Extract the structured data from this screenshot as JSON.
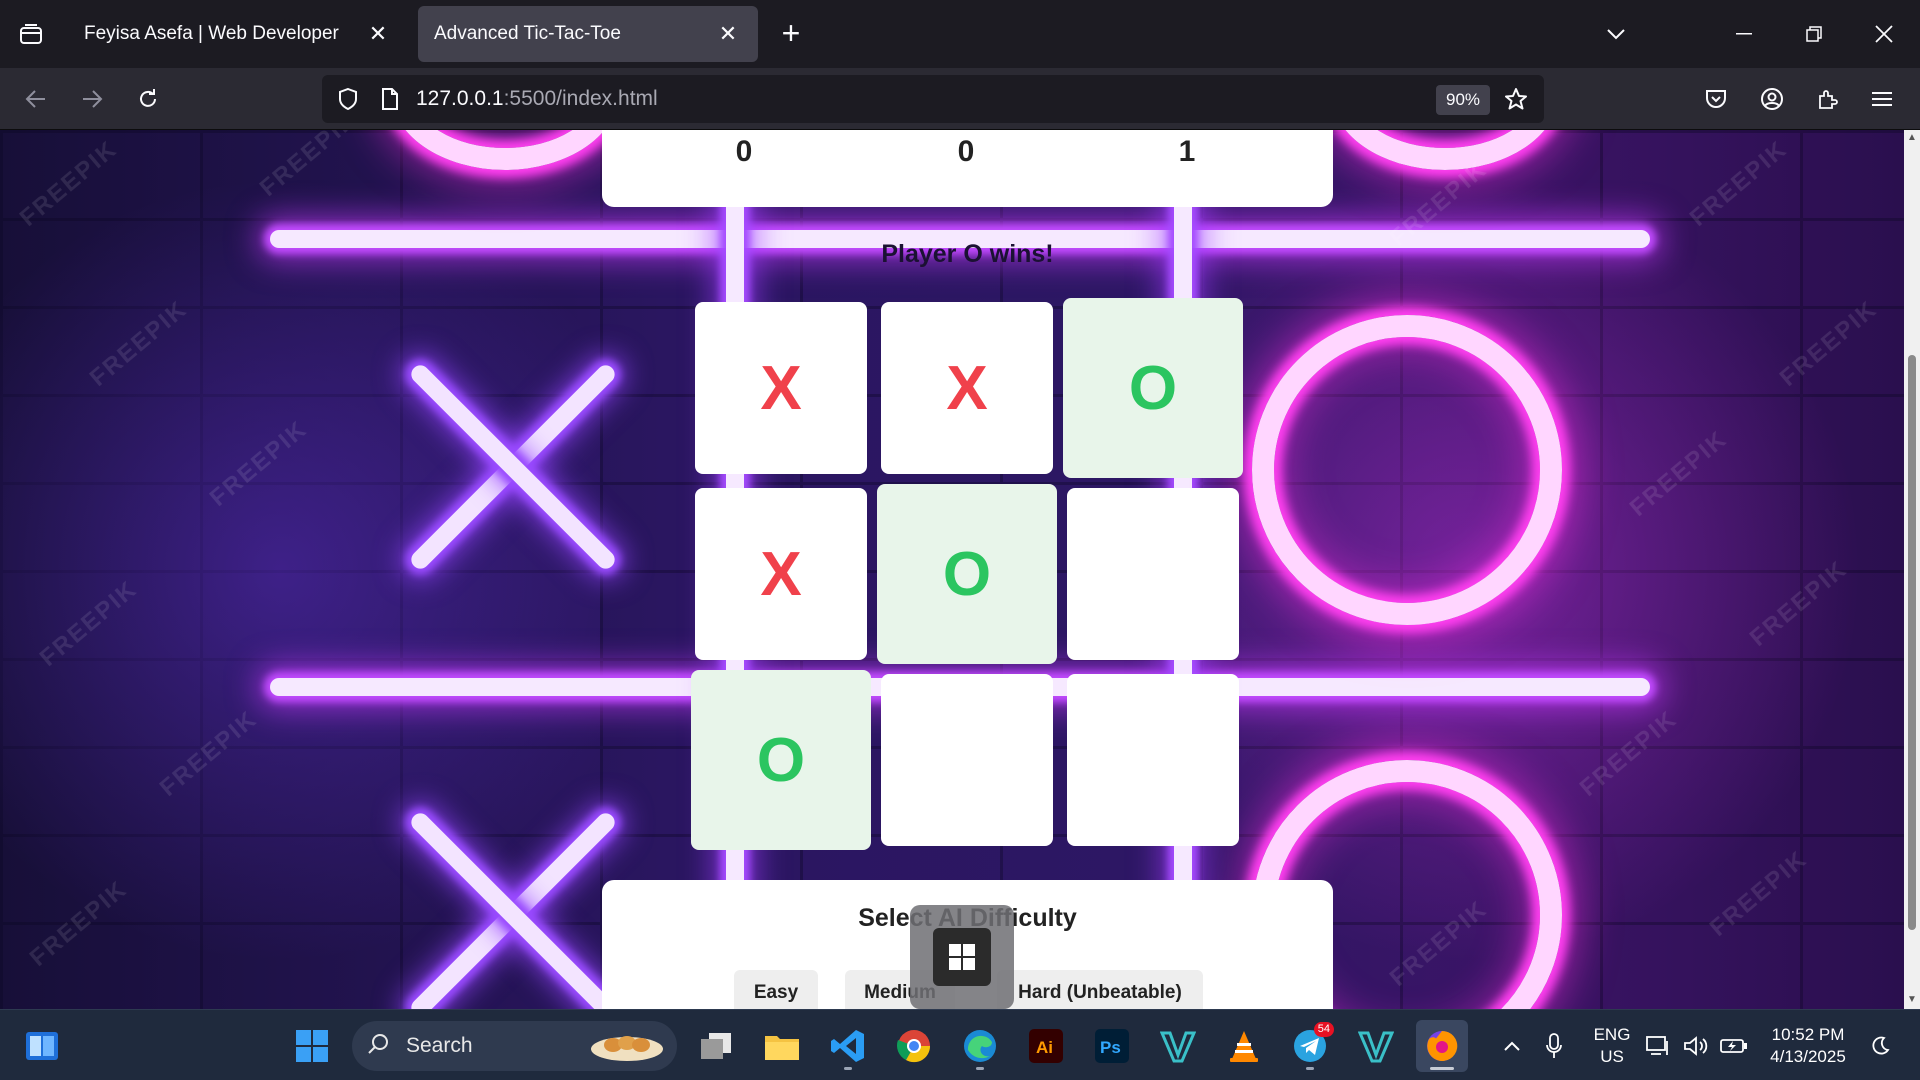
{
  "browser": {
    "tabs": [
      {
        "title": "Feyisa Asefa | Web Developer",
        "active": false
      },
      {
        "title": "Advanced Tic-Tac-Toe",
        "active": true
      }
    ],
    "url_host": "127.0.0.1",
    "url_path": ":5500/index.html",
    "zoom": "90%"
  },
  "game": {
    "scores": [
      "0",
      "0",
      "1"
    ],
    "status": "Player O wins!",
    "board": [
      "X",
      "X",
      "O",
      "X",
      "O",
      "",
      "O",
      "",
      ""
    ],
    "winning_cells": [
      2,
      4,
      6
    ],
    "difficulty_title": "Select AI Difficulty",
    "difficulty_options": [
      "Easy",
      "Medium",
      "Hard (Unbeatable)"
    ]
  },
  "watermark_text": "FREEPIK",
  "taskbar": {
    "search_placeholder": "Search",
    "telegram_badge": "54",
    "language": "ENG",
    "region": "US",
    "time": "10:52 PM",
    "date": "4/13/2025"
  },
  "colors": {
    "x_mark": "#f0414b",
    "o_mark": "#2bc560",
    "win_cell": "#e8f5ea",
    "neon_pink": "#ff3ff0",
    "neon_purple": "#9a4bff"
  }
}
